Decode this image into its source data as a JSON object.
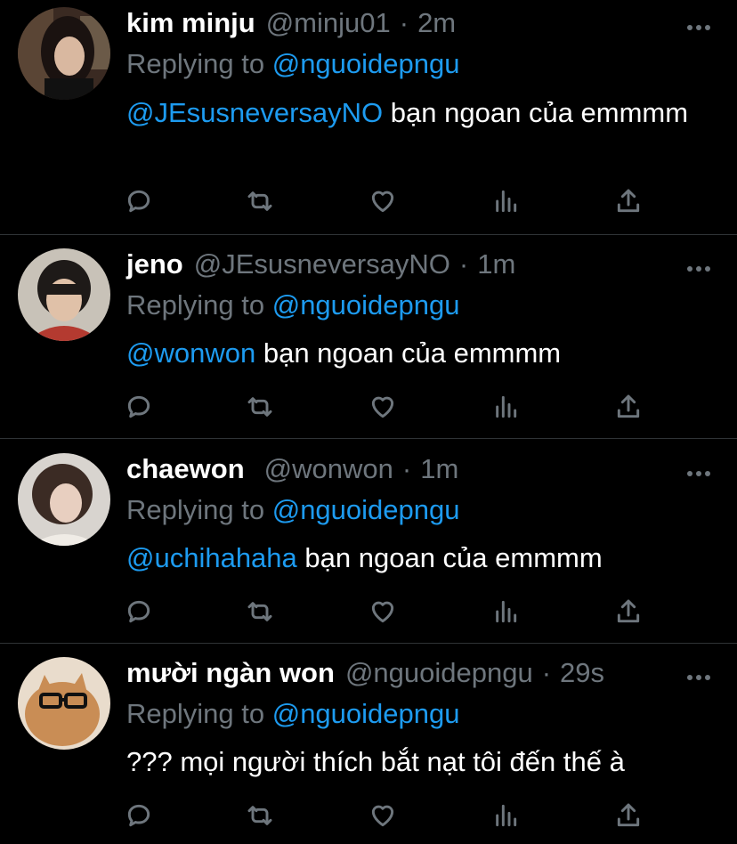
{
  "tweets": [
    {
      "name": "kim minju",
      "handle": "@minju01",
      "time": "2m",
      "replying_label": "Replying to",
      "replying_to": "@nguoidepngu",
      "mention": "@JEsusneversayNO",
      "text": " bạn ngoan của emmmm",
      "avatar": "woman-avatar"
    },
    {
      "name": "jeno",
      "handle": "@JEsusneversayNO",
      "time": "1m",
      "replying_label": "Replying to",
      "replying_to": "@nguoidepngu",
      "mention": "@wonwon",
      "text": " bạn ngoan của emmmm",
      "avatar": "boy-avatar"
    },
    {
      "name": "chaewon",
      "handle": "@wonwon",
      "time": "1m",
      "replying_label": "Replying to",
      "replying_to": "@nguoidepngu",
      "mention": "@uchihahaha",
      "text": " bạn ngoan của emmmm",
      "avatar": "girl-avatar"
    },
    {
      "name": "mười ngàn won",
      "handle": "@nguoidepngu",
      "time": "29s",
      "replying_label": "Replying to",
      "replying_to": "@nguoidepngu",
      "mention": "",
      "text": "??? mọi người thích bắt nạt tôi đến thế à",
      "avatar": "cat-with-glasses-avatar"
    }
  ],
  "separator": "·",
  "icons": [
    "reply-icon",
    "retweet-icon",
    "like-icon",
    "analytics-icon",
    "share-icon",
    "more-icon"
  ],
  "colors": {
    "background": "#000000",
    "text": "#ffffff",
    "muted": "#6e767d",
    "link": "#1d9bf0",
    "divider": "#2f3336"
  }
}
